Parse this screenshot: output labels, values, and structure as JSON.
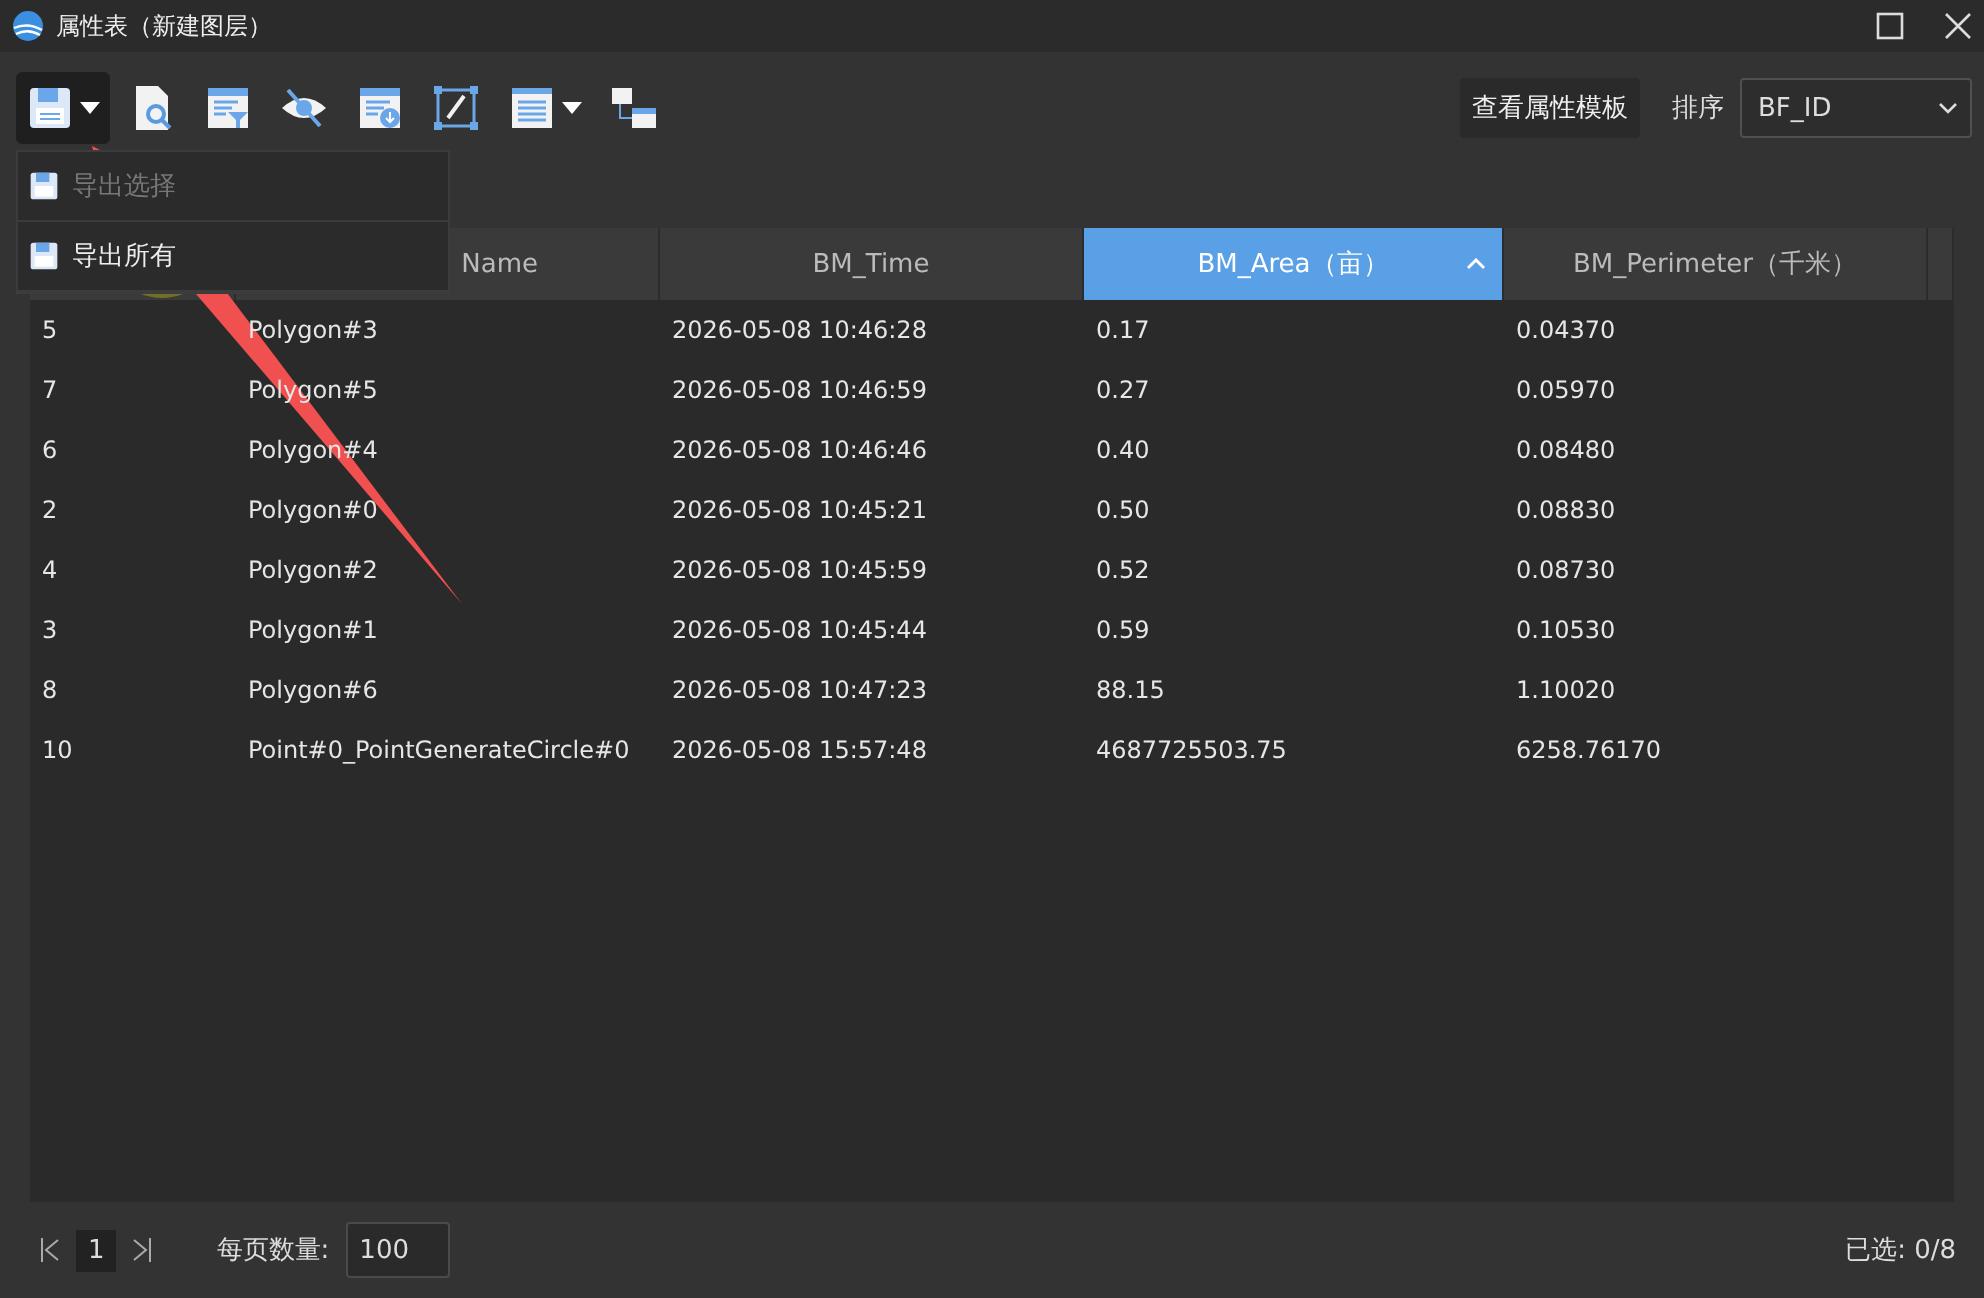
{
  "window": {
    "title": "属性表（新建图层）"
  },
  "toolbar": {
    "tools": [
      {
        "kind": "save",
        "dropdown": true,
        "pressed": true
      },
      {
        "kind": "find",
        "dropdown": false,
        "pressed": false
      },
      {
        "kind": "filter",
        "dropdown": false,
        "pressed": false
      },
      {
        "kind": "hide",
        "dropdown": false,
        "pressed": false
      },
      {
        "kind": "download",
        "dropdown": false,
        "pressed": false
      },
      {
        "kind": "edit",
        "dropdown": false,
        "pressed": false
      },
      {
        "kind": "list",
        "dropdown": true,
        "pressed": false
      },
      {
        "kind": "hierarchy",
        "dropdown": false,
        "pressed": false
      }
    ],
    "template_button": "查看属性模板",
    "sort_label": "排序",
    "sort_value": "BF_ID"
  },
  "export_menu": {
    "items": [
      {
        "label": "导出选择",
        "disabled": true
      },
      {
        "label": "导出所有",
        "disabled": false
      }
    ]
  },
  "table": {
    "columns": [
      {
        "sorted": false
      },
      {
        "label": "Name",
        "sorted": false
      },
      {
        "label": "BM_Time",
        "sorted": false
      },
      {
        "label": "BM_Area（亩）",
        "sorted": true
      },
      {
        "label": "BM_Perimeter（千米）",
        "sorted": false
      }
    ],
    "rows": [
      [
        "5",
        "Polygon#3",
        "2026-05-08 10:46:28",
        "0.17",
        "0.04370"
      ],
      [
        "7",
        "Polygon#5",
        "2026-05-08 10:46:59",
        "0.27",
        "0.05970"
      ],
      [
        "6",
        "Polygon#4",
        "2026-05-08 10:46:46",
        "0.40",
        "0.08480"
      ],
      [
        "2",
        "Polygon#0",
        "2026-05-08 10:45:21",
        "0.50",
        "0.08830"
      ],
      [
        "4",
        "Polygon#2",
        "2026-05-08 10:45:59",
        "0.52",
        "0.08730"
      ],
      [
        "3",
        "Polygon#1",
        "2026-05-08 10:45:44",
        "0.59",
        "0.10530"
      ],
      [
        "8",
        "Polygon#6",
        "2026-05-08 10:47:23",
        "88.15",
        "1.10020"
      ],
      [
        "10",
        "Point#0_PointGenerateCircle#0",
        "2026-05-08 15:57:48",
        "4687725503.75",
        "6258.76170"
      ]
    ]
  },
  "footer": {
    "page": "1",
    "per_page_label": "每页数量:",
    "per_page": "100",
    "selected_count": "已选: 0/8"
  }
}
